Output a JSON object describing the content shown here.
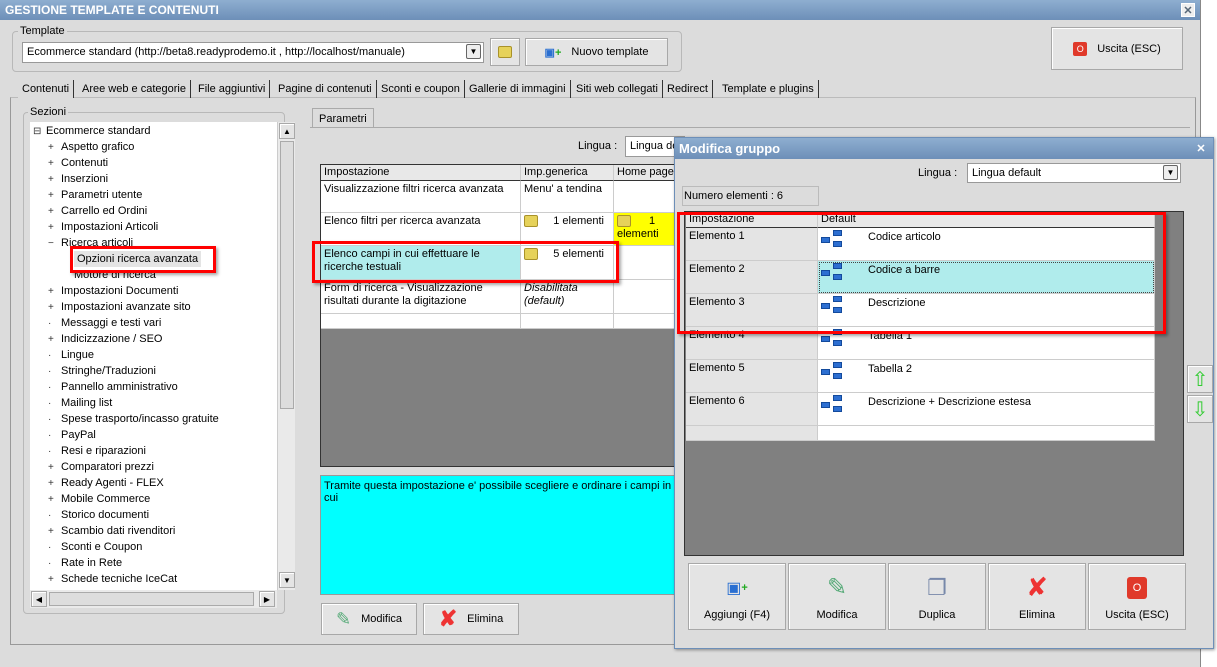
{
  "window": {
    "title": "GESTIONE TEMPLATE E CONTENUTI"
  },
  "template": {
    "label": "Template",
    "value": "Ecommerce standard (http://beta8.readyprodemo.it , http://localhost/manuale)",
    "new_button": "Nuovo template",
    "exit_button": "Uscita (ESC)"
  },
  "tabs": [
    "Contenuti",
    "Aree web e categorie",
    "File aggiuntivi",
    "Pagine di contenuti",
    "Sconti e coupon",
    "Gallerie di immagini",
    "Siti web collegati",
    "Redirect",
    "Template e plugins"
  ],
  "sections": {
    "label": "Sezioni",
    "root": "Ecommerce standard",
    "items": [
      {
        "label": "Aspetto grafico",
        "exp": "+"
      },
      {
        "label": "Contenuti",
        "exp": "+"
      },
      {
        "label": "Inserzioni",
        "exp": "+"
      },
      {
        "label": "Parametri utente",
        "exp": "+"
      },
      {
        "label": "Carrello ed Ordini",
        "exp": "+"
      },
      {
        "label": "Impostazioni Articoli",
        "exp": "+"
      },
      {
        "label": "Ricerca articoli",
        "exp": "−"
      },
      {
        "label": "Opzioni ricerca avanzata",
        "exp": "",
        "child": true,
        "selected": true
      },
      {
        "label": "Motore di ricerca",
        "exp": "",
        "child": true
      },
      {
        "label": "Impostazioni Documenti",
        "exp": "+"
      },
      {
        "label": "Impostazioni avanzate sito",
        "exp": "+"
      },
      {
        "label": "Messaggi e testi vari",
        "exp": ""
      },
      {
        "label": "Indicizzazione / SEO",
        "exp": "+"
      },
      {
        "label": "Lingue",
        "exp": ""
      },
      {
        "label": "Stringhe/Traduzioni",
        "exp": ""
      },
      {
        "label": "Pannello amministrativo",
        "exp": ""
      },
      {
        "label": "Mailing list",
        "exp": ""
      },
      {
        "label": "Spese trasporto/incasso gratuite",
        "exp": ""
      },
      {
        "label": "PayPal",
        "exp": ""
      },
      {
        "label": "Resi e riparazioni",
        "exp": ""
      },
      {
        "label": "Comparatori prezzi",
        "exp": "+"
      },
      {
        "label": "Ready Agenti - FLEX",
        "exp": "+"
      },
      {
        "label": "Mobile Commerce",
        "exp": "+"
      },
      {
        "label": "Storico documenti",
        "exp": ""
      },
      {
        "label": "Scambio dati rivenditori",
        "exp": "+"
      },
      {
        "label": "Sconti e Coupon",
        "exp": ""
      },
      {
        "label": "Rate in Rete",
        "exp": ""
      },
      {
        "label": "Schede tecniche IceCat",
        "exp": "+"
      }
    ]
  },
  "params": {
    "tab": "Parametri",
    "lingua_label": "Lingua :",
    "lingua_value": "Lingua default",
    "headers": [
      "Impostazione",
      "Imp.generica",
      "Home page"
    ],
    "rows": [
      {
        "name": "Visualizzazione filtri ricerca avanzata",
        "generic": "Menu' a tendina",
        "home": ""
      },
      {
        "name": "Elenco filtri per ricerca avanzata",
        "generic": "1 elementi",
        "home": "1 elementi"
      },
      {
        "name": "Elenco campi in cui effettuare le ricerche testuali",
        "generic": "5 elementi",
        "home": ""
      },
      {
        "name": "Form di ricerca - Visualizzazione risultati durante la digitazione",
        "generic": "Disabilitata (default)",
        "home": ""
      }
    ],
    "description": "Tramite questa impostazione e' possibile scegliere e ordinare i campi in cui",
    "edit": "Modifica",
    "delete": "Elimina"
  },
  "dialog": {
    "title": "Modifica gruppo",
    "lingua_label": "Lingua :",
    "lingua_value": "Lingua default",
    "count": "Numero elementi : 6",
    "headers": [
      "Impostazione",
      "Default"
    ],
    "rows": [
      {
        "name": "Elemento 1",
        "value": "Codice articolo"
      },
      {
        "name": "Elemento 2",
        "value": "Codice a barre"
      },
      {
        "name": "Elemento 3",
        "value": "Descrizione"
      },
      {
        "name": "Elemento 4",
        "value": "Tabella 1"
      },
      {
        "name": "Elemento 5",
        "value": "Tabella 2"
      },
      {
        "name": "Elemento 6",
        "value": "Descrizione + Descrizione estesa"
      }
    ],
    "buttons": [
      "Aggiungi (F4)",
      "Modifica",
      "Duplica",
      "Elimina",
      "Uscita (ESC)"
    ]
  },
  "colors": {
    "selected": "#b0ecec",
    "yellow": "#ffff00",
    "cyan": "#00ffff",
    "title": "#6d8fb8"
  }
}
